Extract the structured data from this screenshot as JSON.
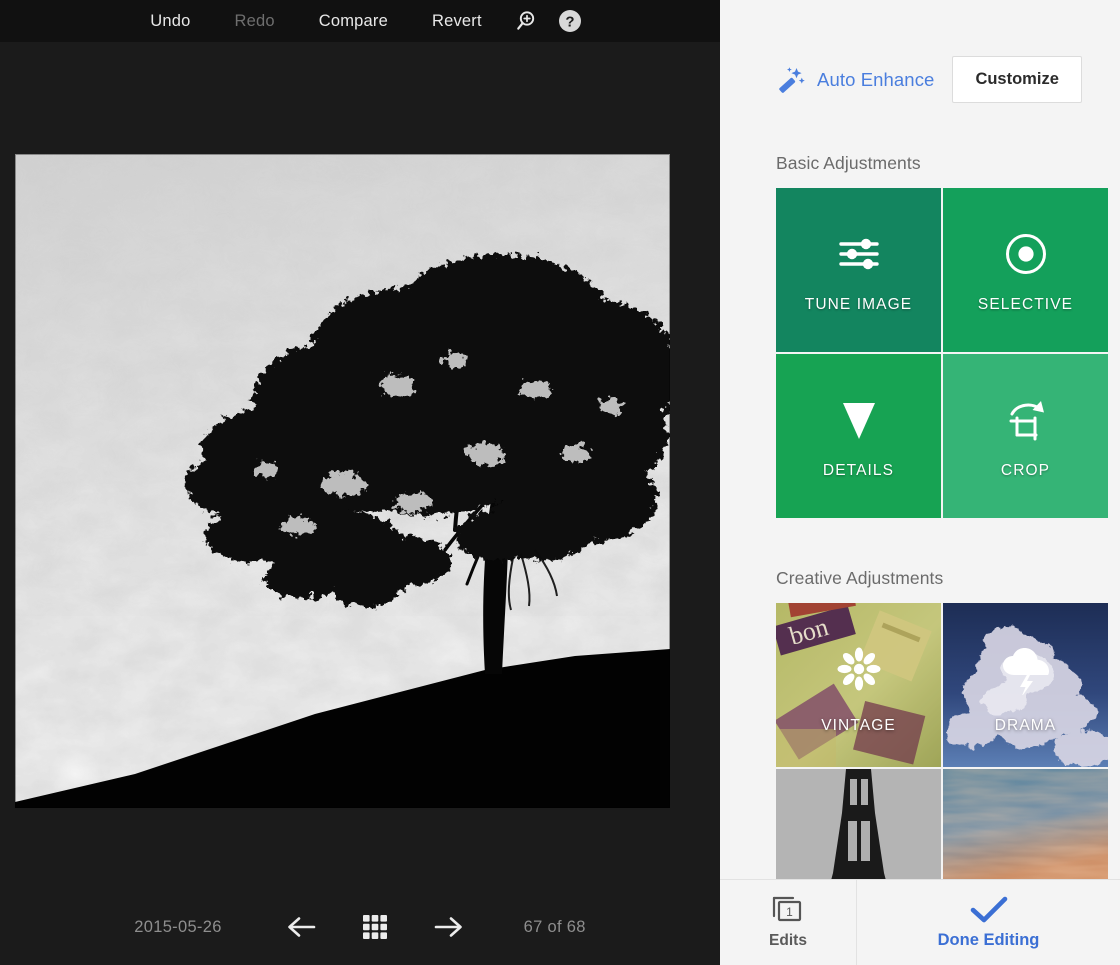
{
  "editor": {
    "toolbar": {
      "undo": "Undo",
      "redo": "Redo",
      "compare": "Compare",
      "revert": "Revert",
      "zoom_icon": "magnifier-plus-icon",
      "help_icon": "help-circle-icon"
    },
    "photo": {
      "description": "black-and-white silhouette of a lone tree on a hillside against a cloudy sky",
      "alt": "tree-silhouette-photo"
    },
    "statusbar": {
      "date": "2015-05-26",
      "prev_icon": "arrow-left-icon",
      "grid_icon": "grid-3x3-icon",
      "next_icon": "arrow-right-icon",
      "position": "67 of 68"
    }
  },
  "panel": {
    "auto_enhance": {
      "label": "Auto Enhance",
      "icon": "magic-wand-icon",
      "color": "#4a7ede"
    },
    "customize_label": "Customize",
    "basic": {
      "title": "Basic Adjustments",
      "tiles": [
        {
          "label": "TUNE IMAGE",
          "icon": "sliders-icon",
          "color": "#13855f"
        },
        {
          "label": "SELECTIVE",
          "icon": "target-dot-icon",
          "color": "#14a05b"
        },
        {
          "label": "DETAILS",
          "icon": "triangle-down-icon",
          "color": "#17a353"
        },
        {
          "label": "CROP",
          "icon": "crop-rotate-icon",
          "color": "#35b476"
        }
      ]
    },
    "creative": {
      "title": "Creative Adjustments",
      "tiles": [
        {
          "label": "VINTAGE",
          "icon": "flower-icon",
          "thumb": "vintage-signs-photo"
        },
        {
          "label": "DRAMA",
          "icon": "cloud-bolt-icon",
          "thumb": "storm-clouds-photo"
        },
        {
          "label": "",
          "icon": "",
          "thumb": "eiffel-tower-bw-photo"
        },
        {
          "label": "",
          "icon": "",
          "thumb": "sunset-sky-photo"
        }
      ]
    },
    "bottom": {
      "edits_label": "Edits",
      "edits_count": "1",
      "edits_icon": "layers-stack-icon",
      "done_label": "Done Editing",
      "done_icon": "check-icon"
    }
  }
}
